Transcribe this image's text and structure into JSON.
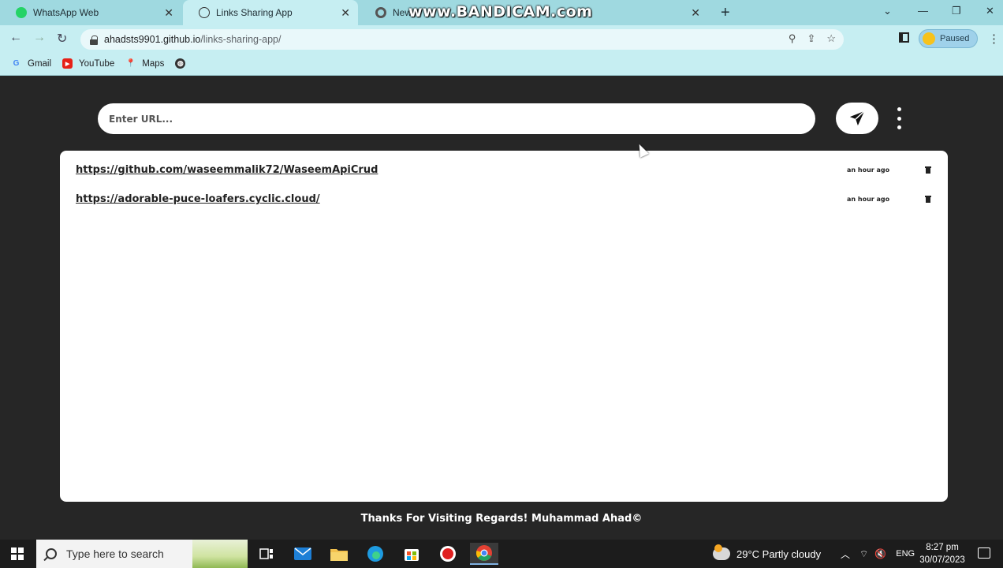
{
  "browser": {
    "tabs": [
      {
        "title": "WhatsApp Web",
        "active": false
      },
      {
        "title": "Links Sharing App",
        "active": true
      },
      {
        "title": "New T",
        "active": false
      }
    ],
    "watermark": "www.BANDICAM.com",
    "address": {
      "host": "ahadsts9901.github.io",
      "path": "/links-sharing-app/"
    },
    "profile_label": "Paused",
    "bookmarks": [
      {
        "label": "Gmail",
        "icon": "google-icon"
      },
      {
        "label": "YouTube",
        "icon": "youtube-icon"
      },
      {
        "label": "Maps",
        "icon": "maps-icon"
      },
      {
        "label": "",
        "icon": "globe-icon"
      }
    ]
  },
  "app": {
    "input_placeholder": "Enter URL...",
    "links": [
      {
        "url": "https://github.com/waseemmalik72/WaseemApiCrud",
        "time": "an hour ago"
      },
      {
        "url": "https://adorable-puce-loafers.cyclic.cloud/",
        "time": "an hour ago"
      }
    ],
    "footer": "Thanks For Visiting Regards! Muhammad Ahad©"
  },
  "taskbar": {
    "search_placeholder": "Type here to search",
    "weather": "29°C  Partly cloudy",
    "language": "ENG",
    "time": "8:27 pm",
    "date": "30/07/2023"
  },
  "colors": {
    "page_background": "#262626",
    "browser_chrome": "#c6eef2",
    "panel": "#ffffff"
  }
}
